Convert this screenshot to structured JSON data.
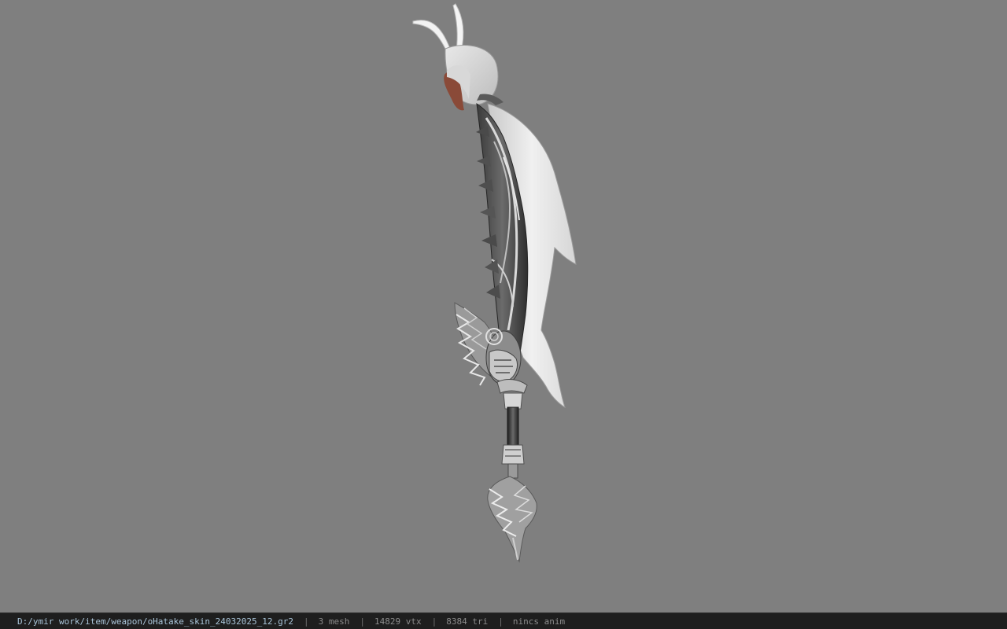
{
  "viewport": {
    "background_color": "#7f7f7f",
    "model_icon": "weapon-model-icon"
  },
  "status_bar": {
    "file_path": "D:/ymir work/item/weapon/oHatake_skin_24032025_12.gr2",
    "separator": "|",
    "mesh_count": "3 mesh",
    "vertex_count": "14829 vtx",
    "triangle_count": "8384 tri",
    "anim_status": "nincs anim",
    "path_color": "#a9c4d8",
    "background_color": "#1e1e1e"
  }
}
